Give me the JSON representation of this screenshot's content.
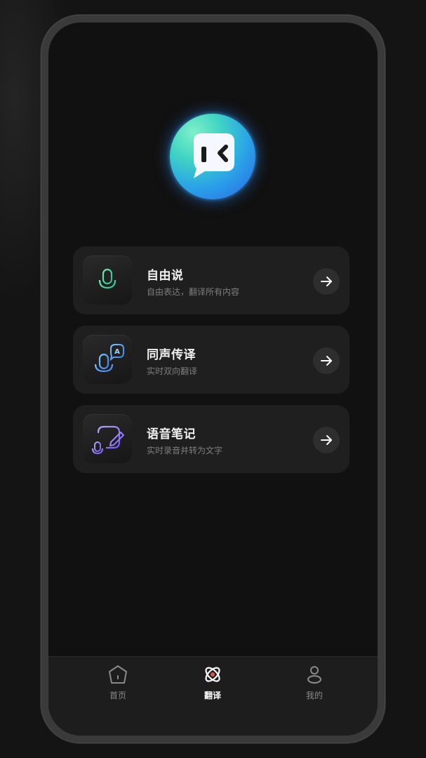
{
  "features": [
    {
      "title": "自由说",
      "subtitle": "自由表达，翻译所有内容",
      "icon": "microphone-waveform-icon"
    },
    {
      "title": "同声传译",
      "subtitle": "实时双向翻译",
      "icon": "speech-translate-icon"
    },
    {
      "title": "语音笔记",
      "subtitle": "实时录音并转为文字",
      "icon": "voice-note-icon"
    }
  ],
  "tabbar": {
    "active": "翻译",
    "items": [
      {
        "label": "首页",
        "icon": "home-icon"
      },
      {
        "label": "翻译",
        "icon": "translate-icon"
      },
      {
        "label": "我的",
        "icon": "profile-icon"
      }
    ]
  },
  "colors": {
    "accent_green": "#3ee0a0",
    "accent_blue": "#4fa6ff",
    "accent_purple": "#8a6cff",
    "active_tab_dot": "#e0524a"
  }
}
